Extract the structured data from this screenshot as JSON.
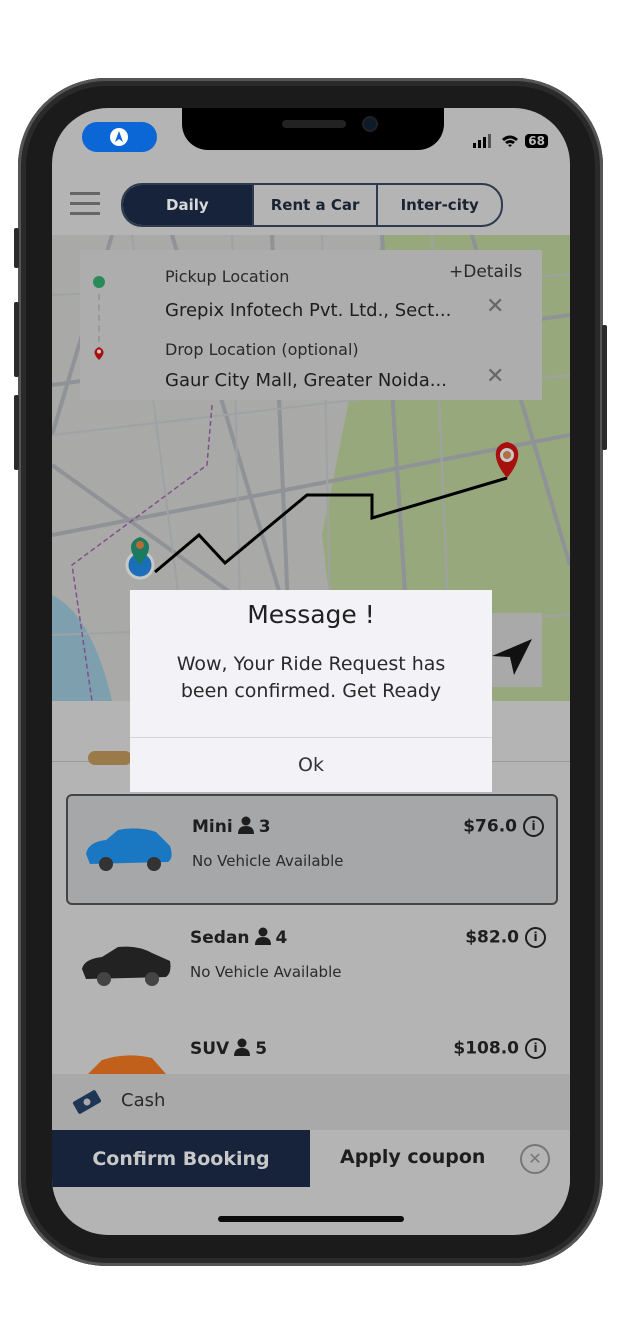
{
  "status_bar": {
    "battery": "68",
    "signal_icon": "cellular-signal-icon",
    "wifi_icon": "wifi-icon"
  },
  "header": {
    "menu_icon": "hamburger-menu-icon",
    "tabs": [
      {
        "label": "Daily",
        "active": true
      },
      {
        "label": "Rent a Car",
        "active": false
      },
      {
        "label": "Inter-city",
        "active": false
      }
    ]
  },
  "locations": {
    "details_link": "+Details",
    "pickup_label": "Pickup Location",
    "pickup_value": "Grepix Infotech Pvt. Ltd., Sect...",
    "drop_label": "Drop Location (optional)",
    "drop_value": "Gaur City Mall, Greater Noida...",
    "clear_icon": "close-icon"
  },
  "map": {
    "route_color": "#000000",
    "pickup_marker_color": "#1c8a6a",
    "drop_marker_color": "#b01010"
  },
  "dialog": {
    "title": "Message !",
    "message": "Wow, Your Ride Request has been confirmed. Get Ready",
    "ok_label": "Ok"
  },
  "vehicles": [
    {
      "name": "Mini",
      "seats": "3",
      "price": "$76.0",
      "availability": "No Vehicle Available",
      "selected": true,
      "color": "#1a78c2"
    },
    {
      "name": "Sedan",
      "seats": "4",
      "price": "$82.0",
      "availability": "No Vehicle Available",
      "selected": false,
      "color": "#222222"
    },
    {
      "name": "SUV",
      "seats": "5",
      "price": "$108.0",
      "selected": false,
      "color": "#c0601a"
    }
  ],
  "payment": {
    "method": "Cash",
    "icon": "cash-icon"
  },
  "footer": {
    "confirm_label": "Confirm Booking",
    "coupon_label": "Apply coupon"
  },
  "colors": {
    "primary": "#16233b",
    "overlay_dim": "#b4b4b4"
  }
}
